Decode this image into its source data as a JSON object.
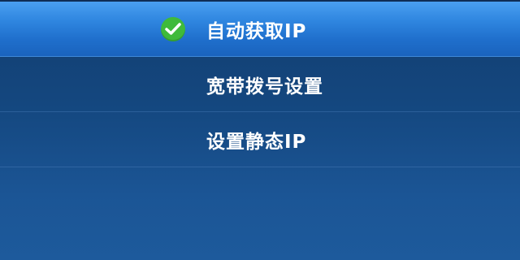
{
  "menu": {
    "items": [
      {
        "label": "自动获取IP",
        "selected": true,
        "icon": "check-circle-icon"
      },
      {
        "label": "宽带拨号设置",
        "selected": false
      },
      {
        "label": "设置静态IP",
        "selected": false
      }
    ]
  },
  "colors": {
    "background": "#14477f",
    "selected_row": "#2f86e0",
    "check": "#3fba3a",
    "text": "#ffffff"
  }
}
